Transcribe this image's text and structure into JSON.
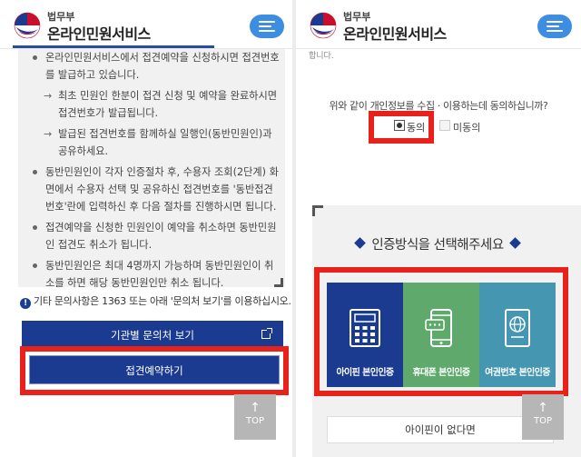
{
  "header": {
    "ministry": "법무부",
    "service_name": "온라인민원서비스",
    "menu_icon": "hamburger-menu-icon",
    "brand_color": "#1b3b91",
    "menu_button_color": "#3d8de3"
  },
  "left": {
    "bullets": [
      {
        "type": "bullet",
        "text": "온라인민원서비스에서 접견예약을 신청하시면 접견번호를 발급하고 있습니다."
      },
      {
        "type": "sub",
        "text": "최초 민원인 한분이 접견 신청 및 예약을 완료하시면 접견번호가 발급됩니다."
      },
      {
        "type": "sub",
        "text": "발급된 접견번호를 함께하실 일행인(동반민원인)과 공유하세요."
      },
      {
        "type": "bullet",
        "text": "동반민원인이 각자 인증절차 후, 수용자 조회(2단계) 화면에서 수용자 선택 및 공유하신 접견번호를 '동반접견번호'란에 입력하신 후 다음 절차를 진행하시면 됩니다."
      },
      {
        "type": "bullet",
        "text": "접견예약을 신청한 민원인이 예약을 취소하면 동반민원인 접견도 취소가 됩니다."
      },
      {
        "type": "bullet",
        "text": "동반민원인은 최대 4명까지 가능하며 동반민원인이 취소를 하면 해당 동반민원인만 취소 됩니다."
      }
    ],
    "notice": "기타 문의사항은 1363 또는 아래 '문의처 보기'를 이용하십시오.",
    "inquiry_button": "기관별 문의처 보기",
    "reserve_button": "접견예약하기",
    "top_button": "TOP",
    "highlight_color": "#e8221a"
  },
  "right": {
    "cutoff_text": "합니다.",
    "consent_question": "위와 같이 개인정보를 수집 · 이용하는데 동의하십니까?",
    "agree_label": "동의",
    "disagree_label": "미동의",
    "agree_selected": true,
    "auth_title": "인증방식을 선택해주세요",
    "auth_options": [
      {
        "label": "아이핀 본인인증",
        "icon": "ipin-calculator-icon",
        "color": "#1b3b91"
      },
      {
        "label": "휴대폰 본인인증",
        "icon": "mobile-phone-icon",
        "color": "#5fa96c"
      },
      {
        "label": "여권번호 본인인증",
        "icon": "passport-icon",
        "color": "#4596b0"
      }
    ],
    "no_ipin_button": "아이핀이 없다면",
    "top_button": "TOP"
  }
}
